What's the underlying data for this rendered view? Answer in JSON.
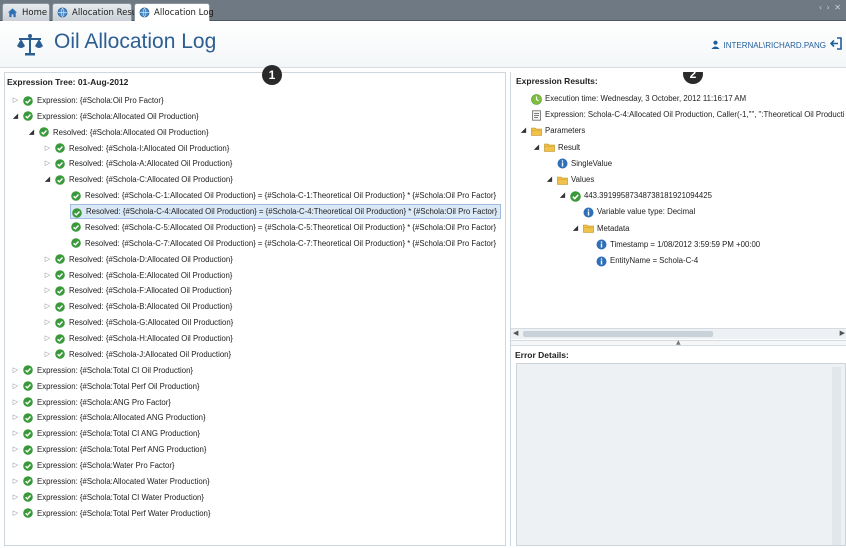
{
  "tabs": [
    {
      "label": "Home",
      "icon": "home-icon"
    },
    {
      "label": "Allocation Results",
      "icon": "globe-icon"
    },
    {
      "label": "Allocation Log",
      "icon": "globe-icon",
      "active": true
    }
  ],
  "window_controls": "‹ › ✕",
  "header": {
    "title": "Oil Allocation Log",
    "user": "INTERNAL\\RICHARD.PANG"
  },
  "left_panel": {
    "title": "Expression Tree: 01-Aug-2012",
    "badge": "1",
    "rows": [
      {
        "depth": 0,
        "expander": "collapsed",
        "label": "Expression: {#Schola:Oil Pro Factor}"
      },
      {
        "depth": 0,
        "expander": "expanded",
        "label": "Expression: {#Schola:Allocated Oil Production}"
      },
      {
        "depth": 1,
        "expander": "expanded",
        "label": "Resolved: {#Schola:Allocated Oil Production}"
      },
      {
        "depth": 2,
        "expander": "collapsed",
        "label": "Resolved: {#Schola-I:Allocated Oil Production}"
      },
      {
        "depth": 2,
        "expander": "collapsed",
        "label": "Resolved: {#Schola-A:Allocated Oil Production}"
      },
      {
        "depth": 2,
        "expander": "expanded",
        "label": "Resolved: {#Schola-C:Allocated Oil Production}"
      },
      {
        "depth": 3,
        "expander": "none",
        "label": "Resolved: {#Schola-C-1:Allocated Oil Production} = {#Schola-C-1:Theoretical Oil Production} * {#Schola:Oil Pro Factor}"
      },
      {
        "depth": 3,
        "expander": "none",
        "selected": true,
        "label": "Resolved: {#Schola-C-4:Allocated Oil Production} = {#Schola-C-4:Theoretical Oil Production} * {#Schola:Oil Pro Factor}"
      },
      {
        "depth": 3,
        "expander": "none",
        "label": "Resolved: {#Schola-C-5:Allocated Oil Production} = {#Schola-C-5:Theoretical Oil Production} * {#Schola:Oil Pro Factor}"
      },
      {
        "depth": 3,
        "expander": "none",
        "label": "Resolved: {#Schola-C-7:Allocated Oil Production} = {#Schola-C-7:Theoretical Oil Production} * {#Schola:Oil Pro Factor}"
      },
      {
        "depth": 2,
        "expander": "collapsed",
        "label": "Resolved: {#Schola-D:Allocated Oil Production}"
      },
      {
        "depth": 2,
        "expander": "collapsed",
        "label": "Resolved: {#Schola-E:Allocated Oil Production}"
      },
      {
        "depth": 2,
        "expander": "collapsed",
        "label": "Resolved: {#Schola-F:Allocated Oil Production}"
      },
      {
        "depth": 2,
        "expander": "collapsed",
        "label": "Resolved: {#Schola-B:Allocated Oil Production}"
      },
      {
        "depth": 2,
        "expander": "collapsed",
        "label": "Resolved: {#Schola-G:Allocated Oil Production}"
      },
      {
        "depth": 2,
        "expander": "collapsed",
        "label": "Resolved: {#Schola-H:Allocated Oil Production}"
      },
      {
        "depth": 2,
        "expander": "collapsed",
        "label": "Resolved: {#Schola-J:Allocated Oil Production}"
      },
      {
        "depth": 0,
        "expander": "collapsed",
        "label": "Expression: {#Schola:Total CI Oil Production}"
      },
      {
        "depth": 0,
        "expander": "collapsed",
        "label": "Expression: {#Schola:Total Perf Oil Production}"
      },
      {
        "depth": 0,
        "expander": "collapsed",
        "label": "Expression: {#Schola:ANG Pro Factor}"
      },
      {
        "depth": 0,
        "expander": "collapsed",
        "label": "Expression: {#Schola:Allocated ANG Production}"
      },
      {
        "depth": 0,
        "expander": "collapsed",
        "label": "Expression: {#Schola:Total CI ANG Production}"
      },
      {
        "depth": 0,
        "expander": "collapsed",
        "label": "Expression: {#Schola:Total Perf ANG Production}"
      },
      {
        "depth": 0,
        "expander": "collapsed",
        "label": "Expression: {#Schola:Water Pro Factor}"
      },
      {
        "depth": 0,
        "expander": "collapsed",
        "label": "Expression: {#Schola:Allocated Water Production}"
      },
      {
        "depth": 0,
        "expander": "collapsed",
        "label": "Expression: {#Schola:Total CI Water Production}"
      },
      {
        "depth": 0,
        "expander": "collapsed",
        "label": "Expression: {#Schola:Total Perf Water Production}"
      }
    ]
  },
  "right_panel": {
    "title": "Expression Results:",
    "badge": "2",
    "rows": [
      {
        "depth": 0,
        "expander": "none",
        "icon": "clock-icon",
        "label": "Execution time: Wednesday, 3 October, 2012 11:16:17 AM"
      },
      {
        "depth": 0,
        "expander": "none",
        "icon": "document-icon",
        "label": "Expression: Schola-C-4:Allocated Oil Production, Caller(-1,\"\", \":Theoretical Oil Producti"
      },
      {
        "depth": 0,
        "expander": "expanded",
        "icon": "folder-icon",
        "label": "Parameters"
      },
      {
        "depth": 1,
        "expander": "expanded",
        "icon": "folder-icon",
        "label": "Result"
      },
      {
        "depth": 2,
        "expander": "none",
        "icon": "info-icon",
        "label": "SingleValue"
      },
      {
        "depth": 2,
        "expander": "expanded",
        "icon": "folder-icon",
        "label": "Values"
      },
      {
        "depth": 3,
        "expander": "expanded",
        "icon": "check-icon",
        "label": "443.39199587348738181921094425"
      },
      {
        "depth": 4,
        "expander": "none",
        "icon": "info-icon",
        "label": "Variable value type: Decimal"
      },
      {
        "depth": 4,
        "expander": "expanded",
        "icon": "folder-icon",
        "label": "Metadata"
      },
      {
        "depth": 5,
        "expander": "none",
        "icon": "info-icon",
        "label": "Timestamp = 1/08/2012 3:59:59 PM +00:00"
      },
      {
        "depth": 5,
        "expander": "none",
        "icon": "info-icon",
        "label": "EntityName = Schola-C-4"
      }
    ],
    "error_title": "Error Details:"
  },
  "colors": {
    "accent": "#2d5e92",
    "check": "#3a9a3a",
    "selection": "#dbe8f6",
    "tabbar": "#6e7983"
  }
}
